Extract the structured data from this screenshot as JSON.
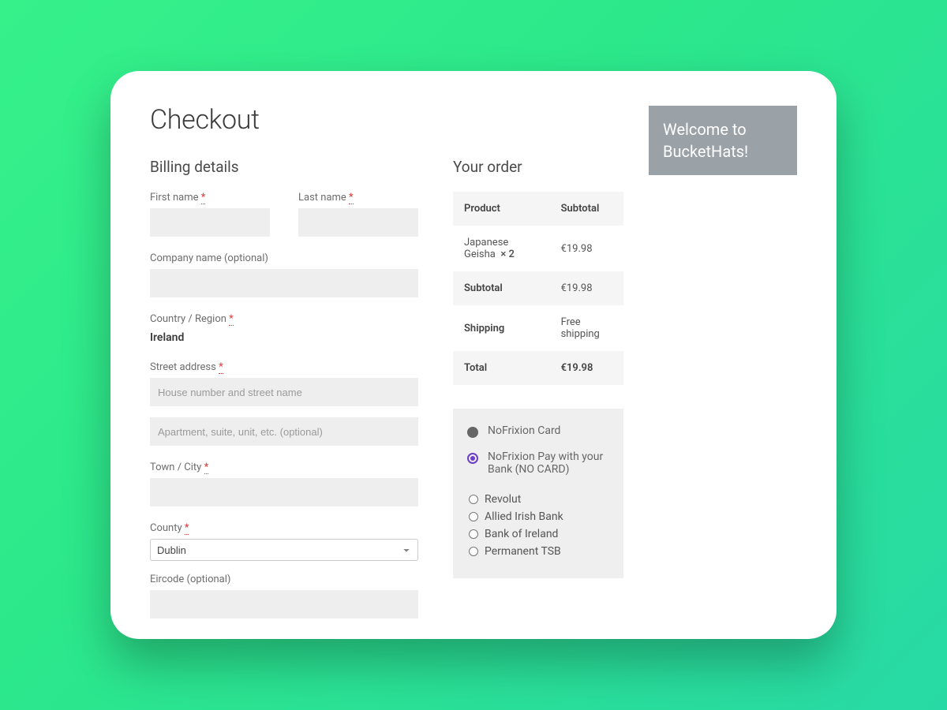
{
  "page": {
    "title": "Checkout"
  },
  "sidebar": {
    "welcome": "Welcome to BucketHats!"
  },
  "billing": {
    "heading": "Billing details",
    "first_name_label": "First name",
    "last_name_label": "Last name",
    "company_label": "Company name (optional)",
    "country_label": "Country / Region",
    "country_value": "Ireland",
    "street_label": "Street address",
    "street_placeholder": "House number and street name",
    "street2_placeholder": "Apartment, suite, unit, etc. (optional)",
    "town_label": "Town / City",
    "county_label": "County",
    "county_value": "Dublin",
    "eircode_label": "Eircode (optional)",
    "required_mark": "*"
  },
  "order": {
    "heading": "Your order",
    "col_product": "Product",
    "col_subtotal": "Subtotal",
    "items": [
      {
        "name": "Japanese Geisha",
        "qty": "× 2",
        "subtotal": "€19.98"
      }
    ],
    "rows": {
      "subtotal_label": "Subtotal",
      "subtotal_value": "€19.98",
      "shipping_label": "Shipping",
      "shipping_value": "Free shipping",
      "total_label": "Total",
      "total_value": "€19.98"
    }
  },
  "payment": {
    "methods": [
      {
        "label": "NoFrixion Card",
        "selected": false
      },
      {
        "label": "NoFrixion Pay with your Bank (NO CARD)",
        "selected": true
      }
    ],
    "banks": [
      "Revolut",
      "Allied Irish Bank",
      "Bank of Ireland",
      "Permanent TSB"
    ]
  }
}
